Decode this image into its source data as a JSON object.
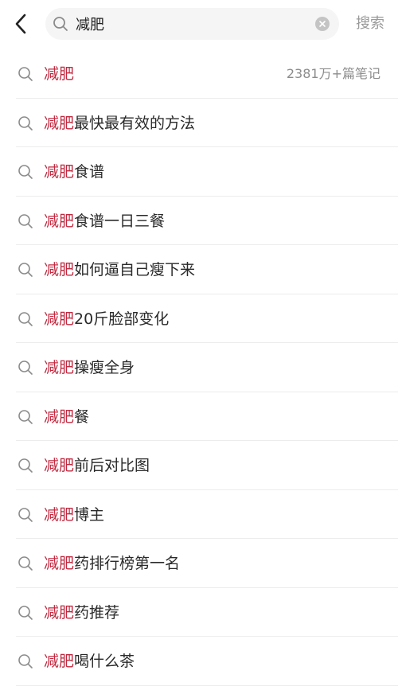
{
  "header": {
    "search": {
      "value": "减肥",
      "placeholder": ""
    },
    "search_button_label": "搜索"
  },
  "suggestions": [
    {
      "highlight": "减肥",
      "rest": "",
      "count": "2381万+篇笔记"
    },
    {
      "highlight": "减肥",
      "rest": "最快最有效的方法"
    },
    {
      "highlight": "减肥",
      "rest": "食谱"
    },
    {
      "highlight": "减肥",
      "rest": "食谱一日三餐"
    },
    {
      "highlight": "减肥",
      "rest": "如何逼自己瘦下来"
    },
    {
      "highlight": "减肥",
      "rest": "20斤脸部变化"
    },
    {
      "highlight": "减肥",
      "rest": "操瘦全身"
    },
    {
      "highlight": "减肥",
      "rest": "餐"
    },
    {
      "highlight": "减肥",
      "rest": "前后对比图"
    },
    {
      "highlight": "减肥",
      "rest": "博主"
    },
    {
      "highlight": "减肥",
      "rest": "药排行榜第一名"
    },
    {
      "highlight": "减肥",
      "rest": "药推荐"
    },
    {
      "highlight": "减肥",
      "rest": "喝什么茶"
    }
  ],
  "colors": {
    "highlight": "#c0293f",
    "text": "#2a2a2a",
    "muted": "#9a9a9a",
    "search_bg": "#f5f5f5"
  },
  "icons": {
    "back": "chevron-left-icon",
    "search": "search-icon",
    "clear": "clear-icon"
  }
}
